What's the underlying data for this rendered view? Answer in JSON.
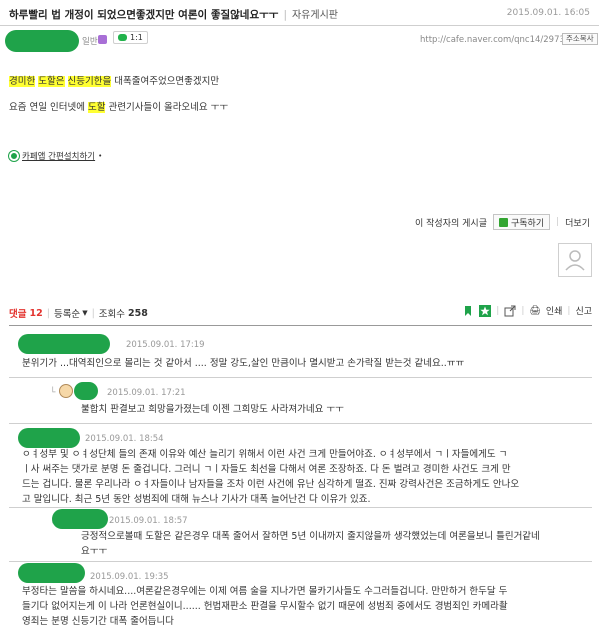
{
  "post": {
    "title": "하루빨리 법 개정이 되었으면좋겠지만 여론이 좋질않네요ㅜㅜ",
    "board": "자유게시판",
    "date": "2015.09.01. 16:05",
    "level_suffix": "일반",
    "chat_label": "1:1",
    "url": "http://cafe.naver.com/qnc14/2973",
    "copy_label": "주소복사",
    "line1_hl1": "경미한",
    "line1_hl2": "도할은",
    "line1_hl3": "신등기한을",
    "line1_rest": " 대폭줄여주었으면좋겠지만",
    "line2_pre": "요즘  연일 인터넷에  ",
    "line2_hl": "도할",
    "line2_rest": " 관련기사들이 올라오네요 ㅜㅜ",
    "cafe_app_label": "카페앱 간편설치하기"
  },
  "author_bar": {
    "author_posts": "이 작성자의 게시글",
    "subscribe": "구독하기",
    "more": "더보기"
  },
  "comments_header": {
    "label": "댓글",
    "count": "12",
    "sort": "등록순",
    "views_label": "조회수",
    "views": "258",
    "print": "인쇄",
    "report": "신고"
  },
  "comments": [
    {
      "date": "2015.09.01. 17:19",
      "text": "분위기가 ...대역죄인으로 몰리는 것 같아서 .... 정말 강도,살인 만큼이나 멸시받고 손가락질 받는것 같네요..ㅠㅠ"
    },
    {
      "date": "2015.09.01. 17:21",
      "text": "불합치 판결보고 희망을가졌는데 이젠 그희망도 사라져가네요 ㅜㅜ"
    },
    {
      "date": "2015.09.01. 18:54",
      "text": "ㅇㅕ성부 및 ㅇㅕ성단체 들의 존재 이유와 예산 늘리기 위해서 이런 사건 크게 만들어야죠. ㅇㅕ성부에서 ㄱㅣ자들에게도 ㄱ\nㅣ사 써주는 댓가로 분명 돈 줄겁니다. 그러니 ㄱㅣ자들도 최선을 다해서 여론 조장하죠. 다 돈 벌려고 경미한 사건도 크게 만\n드는 겁니다. 물론 우리나라 ㅇㅕ자들이나 남자들을 조차 이런 사건에 유난 심각하게 떨죠. 진짜 강력사건은 조금하게도 안나오\n고 말입니다. 최근 5년 동안 성범죄에 대해 뉴스나 기사가 대폭 늘어난건 다 이유가 있죠."
    },
    {
      "date": "2015.09.01. 18:57",
      "text": "긍정적으로볼때 도할은 같은경우 대폭 줄어서 잘하면 5년 이내까지 줄지않을까 생각했었는데 여론을보니 틀린거같네\n요ㅜㅜ"
    },
    {
      "date": "2015.09.01. 19:35",
      "text": "부정타는 말씀을 하시네요....여론같은경우에는 이제 여름 술을 지나가면 몰카기사들도 수그러들겁니다. 만만하거 한두달 두\n들기다 없어지는게 이 나라 언론현실이니...... 헌법재판소 판결을 무시할수 없기 때문에 성범죄 중에서도 경범죄인 카메라촬\n영죄는 분명 신등기간 대폭 줄어듭니다"
    }
  ],
  "colors": {
    "name_blob": "#1fa34a",
    "highlight": "#ffff33",
    "comment_count": "#e3342f"
  }
}
